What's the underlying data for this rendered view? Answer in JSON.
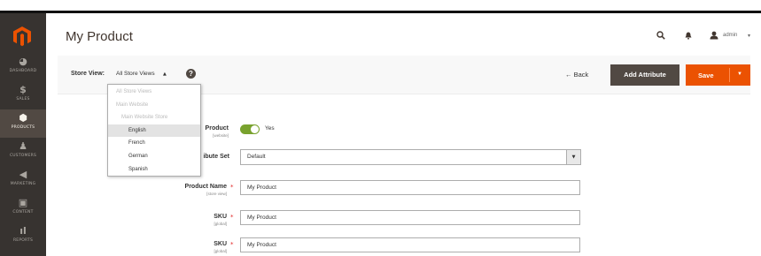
{
  "sidebar": {
    "items": [
      {
        "label": "DASHBOARD",
        "icon": "dashboard-icon",
        "glyph": "◕"
      },
      {
        "label": "SALES",
        "icon": "dollar-icon",
        "glyph": "$"
      },
      {
        "label": "PRODUCTS",
        "icon": "cube-icon",
        "glyph": "⬢"
      },
      {
        "label": "CUSTOMERS",
        "icon": "person-icon",
        "glyph": "♟"
      },
      {
        "label": "MARKETING",
        "icon": "megaphone-icon",
        "glyph": "◀"
      },
      {
        "label": "CONTENT",
        "icon": "layout-icon",
        "glyph": "▣"
      },
      {
        "label": "REPORTS",
        "icon": "bar-chart-icon",
        "glyph": "ıl"
      }
    ],
    "active": "PRODUCTS"
  },
  "header": {
    "title": "My Product",
    "user": "admin",
    "user_caret": "▾"
  },
  "store_view": {
    "label": "Store View:",
    "value": "All Store Views",
    "caret": "▲",
    "help": "?"
  },
  "toolbar": {
    "back_label": "← Back",
    "add_attribute_label": "Add Attribute",
    "save_label": "Save",
    "save_caret": "▼"
  },
  "dropdown": {
    "disabled": [
      "All Store Views",
      "Main Website",
      "Main Website Store"
    ],
    "options": [
      "English",
      "French",
      "German",
      "Spanish"
    ],
    "hovered": "English"
  },
  "form": {
    "enable_label": "Product",
    "enable_scope": "[website]",
    "enable_value": "Yes",
    "attribute_set_label": "ibute Set",
    "attribute_set_value": "Default",
    "product_name_label": "Product Name",
    "product_name_scope": "[store view]",
    "product_name_value": "My Product",
    "sku_label": "SKU",
    "sku_scope": "[global]",
    "sku_value": "My Product",
    "sku2_label": "SKU",
    "sku2_scope": "[global]",
    "sku2_value": "My Product",
    "required_mark": "*"
  },
  "colors": {
    "sidebar_bg": "#373330",
    "accent": "#eb5202",
    "secondary_button": "#514943",
    "toggle_on": "#79a22e"
  }
}
